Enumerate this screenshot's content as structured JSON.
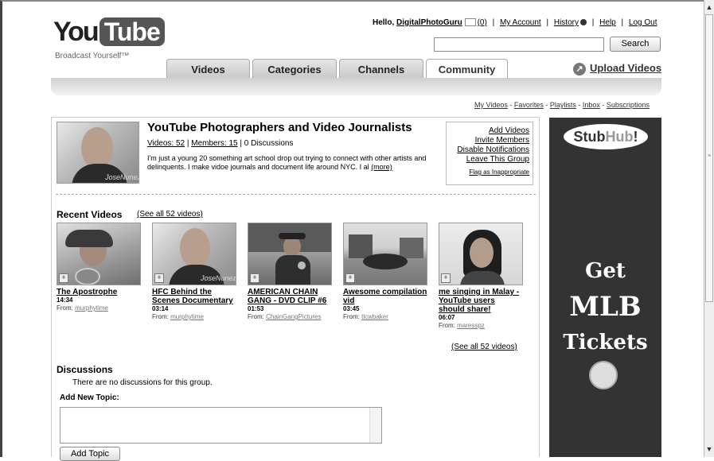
{
  "header": {
    "logo_you": "You",
    "logo_tube": "Tube",
    "tagline": "Broadcast Yourself™",
    "greeting": "Hello,",
    "username": "DigitalPhotoGuru",
    "inbox_count": "(0)",
    "my_account": "My Account",
    "history": "History",
    "help": "Help",
    "logout": "Log Out",
    "search_button": "Search",
    "search_value": ""
  },
  "nav": {
    "tabs": [
      "Videos",
      "Categories",
      "Channels",
      "Community"
    ],
    "active_tab": "Community",
    "upload": "Upload Videos"
  },
  "my_links": [
    "My Videos",
    "Favorites",
    "Playlists",
    "Inbox",
    "Subscriptions"
  ],
  "group": {
    "title": "YouTube Photographers and Video Journalists",
    "videos": "Videos: 52",
    "members": "Members: 15",
    "discussions": "0 Discussions",
    "description": "I'm just a young 20 something art school drop out trying to connect with other artists and delinquents. I make vidoe journals and document life around NYC. I al",
    "more": "(more)",
    "thumb_caption": "JoseNunez"
  },
  "actions": {
    "add_videos": "Add Videos",
    "invite": "Invite Members",
    "disable": "Disable Notifications",
    "leave": "Leave This Group",
    "flag": "Flag as Inappropriate"
  },
  "recent": {
    "heading": "Recent Videos",
    "see_all": "(See all 52 videos)",
    "videos": [
      {
        "title": "The Apostrophe",
        "duration": "14:34",
        "from": "From:",
        "user": "murphytime"
      },
      {
        "title": "HFC Behind the Scenes Documentary",
        "duration": "03:14",
        "from": "From:",
        "user": "murphytime"
      },
      {
        "title": "AMERICAN CHAIN GANG - DVD CLIP #6",
        "duration": "01:53",
        "from": "From:",
        "user": "ChainGangPictures"
      },
      {
        "title": "Awesome compilation vid",
        "duration": "03:45",
        "from": "From:",
        "user": "tlcwbaker"
      },
      {
        "title": "me singing in Malay - YouTube users should share!",
        "duration": "06:07",
        "from": "From:",
        "user": "maresspz"
      }
    ],
    "see_all_bottom": "(See all 52 videos)"
  },
  "discussions": {
    "heading": "Discussions",
    "empty": "There are no discussions for this group.",
    "add_new": "Add New Topic:",
    "add_button": "Add Topic"
  },
  "ad": {
    "brand_a": "Stub",
    "brand_b": "Hub",
    "brand_c": "!",
    "line1": "Get",
    "line2": "MLB",
    "line3": "Tickets"
  }
}
